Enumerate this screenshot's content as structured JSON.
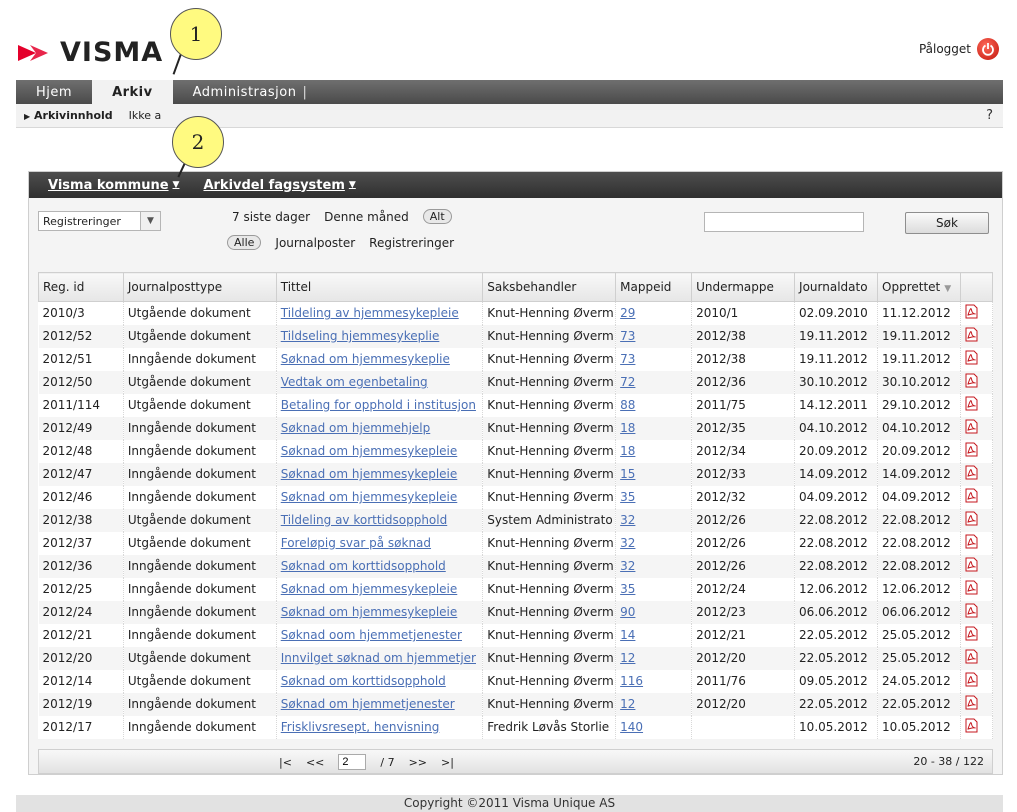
{
  "header": {
    "brand": "VISMA",
    "user_label": "Pålogget",
    "brand_color": "#e4002b"
  },
  "nav": {
    "tabs": [
      {
        "label": "Hjem"
      },
      {
        "label": "Arkiv"
      },
      {
        "label": "Administrasjon"
      }
    ],
    "separator": "|"
  },
  "subnav": {
    "items": [
      "Arkivinnhold",
      "Ikke a"
    ],
    "help": "?"
  },
  "panel": {
    "crumbs": [
      {
        "label": "Visma kommune"
      },
      {
        "label": "Arkivdel fagsystem"
      }
    ]
  },
  "filters": {
    "select_value": "Registreringer",
    "row1": [
      "7 siste dager",
      "Denne måned",
      "Alt"
    ],
    "row2": [
      "Alle",
      "Journalposter",
      "Registreringer"
    ],
    "search_placeholder": "",
    "search_button": "Søk"
  },
  "table": {
    "columns": [
      "Reg. id",
      "Journalposttype",
      "Tittel",
      "Saksbehandler",
      "Mappeid",
      "Undermappe",
      "Journaldato",
      "Opprettet",
      ""
    ],
    "rows": [
      [
        "2010/3",
        "Utgående dokument",
        "Tildeling av hjemmesykepleie",
        "Knut-Henning Øverm",
        "29",
        "2010/1",
        "02.09.2010",
        "11.12.2012"
      ],
      [
        "2012/52",
        "Utgående dokument",
        "Tildseling hjemmesykeplie",
        "Knut-Henning Øverm",
        "73",
        "2012/38",
        "19.11.2012",
        "19.11.2012"
      ],
      [
        "2012/51",
        "Inngående dokument",
        "Søknad om hjemmesykeplie",
        "Knut-Henning Øverm",
        "73",
        "2012/38",
        "19.11.2012",
        "19.11.2012"
      ],
      [
        "2012/50",
        "Utgående dokument",
        "Vedtak om egenbetaling",
        "Knut-Henning Øverm",
        "72",
        "2012/36",
        "30.10.2012",
        "30.10.2012"
      ],
      [
        "2011/114",
        "Utgående dokument",
        "Betaling for opphold i institusjon",
        "Knut-Henning Øverm",
        "88",
        "2011/75",
        "14.12.2011",
        "29.10.2012"
      ],
      [
        "2012/49",
        "Inngående dokument",
        "Søknad om hjemmehjelp",
        "Knut-Henning Øverm",
        "18",
        "2012/35",
        "04.10.2012",
        "04.10.2012"
      ],
      [
        "2012/48",
        "Inngående dokument",
        "Søknad om hjemmesykepleie",
        "Knut-Henning Øverm",
        "18",
        "2012/34",
        "20.09.2012",
        "20.09.2012"
      ],
      [
        "2012/47",
        "Inngående dokument",
        "Søknad om hjemmesykepleie",
        "Knut-Henning Øverm",
        "15",
        "2012/33",
        "14.09.2012",
        "14.09.2012"
      ],
      [
        "2012/46",
        "Inngående dokument",
        "Søknad om hjemmesykepleie",
        "Knut-Henning Øverm",
        "35",
        "2012/32",
        "04.09.2012",
        "04.09.2012"
      ],
      [
        "2012/38",
        "Utgående dokument",
        "Tildeling av korttidsopphold",
        "System Administrato",
        "32",
        "2012/26",
        "22.08.2012",
        "22.08.2012"
      ],
      [
        "2012/37",
        "Utgående dokument",
        "Foreløpig svar på søknad",
        "Knut-Henning Øverm",
        "32",
        "2012/26",
        "22.08.2012",
        "22.08.2012"
      ],
      [
        "2012/36",
        "Inngående dokument",
        "Søknad om korttidsopphold",
        "Knut-Henning Øverm",
        "32",
        "2012/26",
        "22.08.2012",
        "22.08.2012"
      ],
      [
        "2012/25",
        "Inngående dokument",
        "Søknad om hjemmesykepleie",
        "Knut-Henning Øverm",
        "35",
        "2012/24",
        "12.06.2012",
        "12.06.2012"
      ],
      [
        "2012/24",
        "Inngående dokument",
        "Søknad om hjemmesykepleie",
        "Knut-Henning Øverm",
        "90",
        "2012/23",
        "06.06.2012",
        "06.06.2012"
      ],
      [
        "2012/21",
        "Inngående dokument",
        "Søknad oom hjemmetjenester",
        "Knut-Henning Øverm",
        "14",
        "2012/21",
        "22.05.2012",
        "25.05.2012"
      ],
      [
        "2012/20",
        "Utgående dokument",
        "Innvilget søknad om hjemmetjer",
        "Knut-Henning Øverm",
        "12",
        "2012/20",
        "22.05.2012",
        "25.05.2012"
      ],
      [
        "2012/14",
        "Utgående dokument",
        "Søknad om korttidsopphold",
        "Knut-Henning Øverm",
        "116",
        "2011/76",
        "09.05.2012",
        "24.05.2012"
      ],
      [
        "2012/19",
        "Inngående dokument",
        "Søknad om hjemmetjenester",
        "Knut-Henning Øverm",
        "12",
        "2012/20",
        "22.05.2012",
        "22.05.2012"
      ],
      [
        "2012/17",
        "Inngående dokument",
        "Frisklivsresept, henvisning",
        "Fredrik Løvås Storlie",
        "140",
        "",
        "10.05.2012",
        "10.05.2012"
      ]
    ]
  },
  "pager": {
    "first": "|<",
    "prev": "<<",
    "page": "2",
    "total": "/ 7",
    "next": ">>",
    "last": ">|",
    "info": "20 - 38 / 122"
  },
  "footer": "Copyright ©2011 Visma Unique AS",
  "callouts": [
    "1",
    "2"
  ]
}
